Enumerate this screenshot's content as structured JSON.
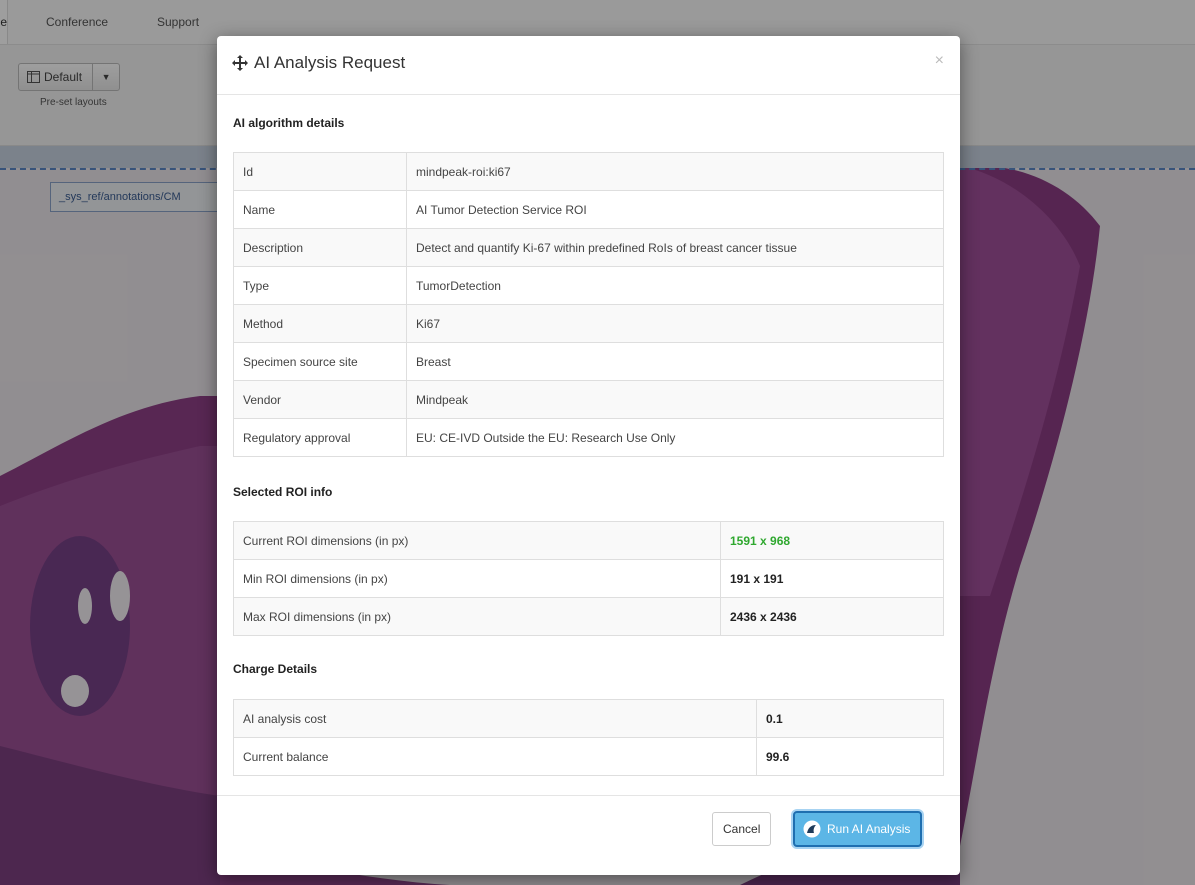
{
  "nav": {
    "active_tab": "e",
    "tabs": [
      "Conference",
      "Support"
    ]
  },
  "toolbar": {
    "layout_button": "Default",
    "preset_label": "Pre-set layouts"
  },
  "viewer": {
    "annotation_path": "_sys_ref/annotations/CM"
  },
  "modal": {
    "title": "AI Analysis Request",
    "close": "×",
    "sections": {
      "algorithm": "AI algorithm details",
      "roi": "Selected ROI info",
      "charge": "Charge Details"
    },
    "algorithm_rows": [
      {
        "key": "Id",
        "value": "mindpeak-roi:ki67"
      },
      {
        "key": "Name",
        "value": "AI Tumor Detection Service ROI"
      },
      {
        "key": "Description",
        "value": "Detect and quantify Ki-67 within predefined RoIs of breast cancer tissue"
      },
      {
        "key": "Type",
        "value": "TumorDetection"
      },
      {
        "key": "Method",
        "value": "Ki67"
      },
      {
        "key": "Specimen source site",
        "value": "Breast"
      },
      {
        "key": "Vendor",
        "value": "Mindpeak"
      },
      {
        "key": "Regulatory approval",
        "value": "EU: CE-IVD Outside the EU: Research Use Only"
      }
    ],
    "roi_rows": [
      {
        "key": "Current ROI dimensions (in px)",
        "value": "1591 x 968"
      },
      {
        "key": "Min ROI dimensions (in px)",
        "value": "191 x 191"
      },
      {
        "key": "Max ROI dimensions (in px)",
        "value": "2436 x 2436"
      }
    ],
    "charge_rows": [
      {
        "key": "AI analysis cost",
        "value": "0.1"
      },
      {
        "key": "Current balance",
        "value": "99.6"
      }
    ],
    "buttons": {
      "cancel": "Cancel",
      "run": "Run AI Analysis"
    },
    "colors": {
      "ok_value": "#2fa82f",
      "run_button": "#5cb6e6"
    }
  }
}
